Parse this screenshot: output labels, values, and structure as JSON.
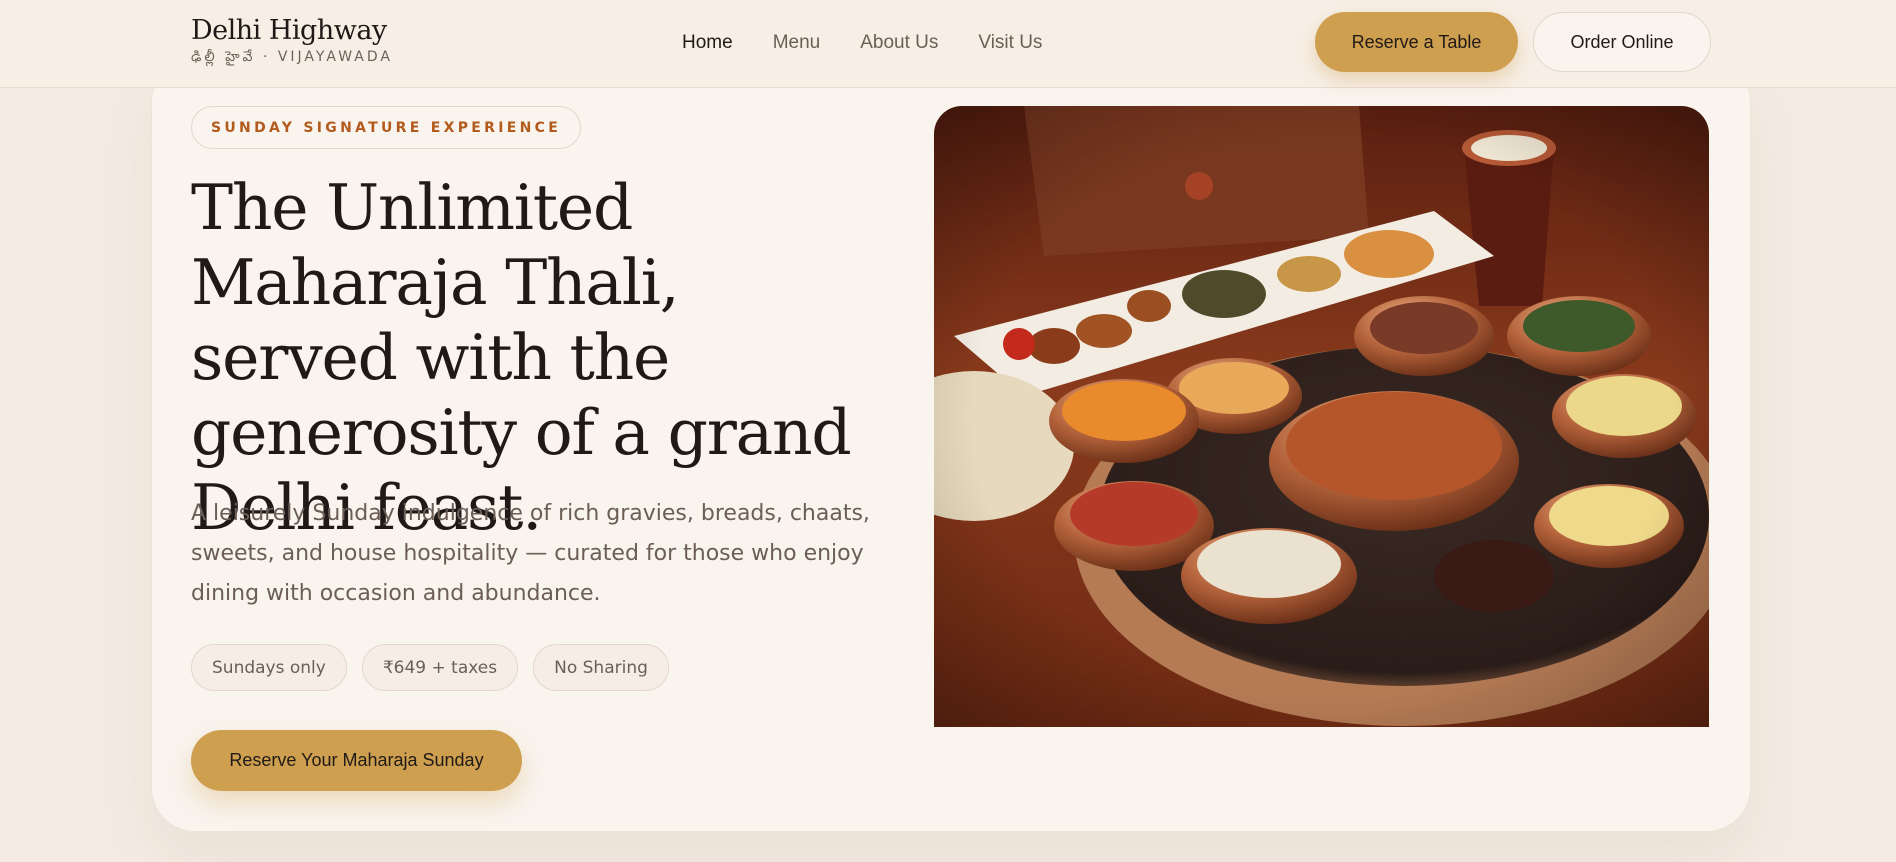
{
  "brand": {
    "name": "Delhi Highway",
    "subtitle": "ఢిల్లీ హైవే · VIJAYAWADA"
  },
  "nav": {
    "items": [
      {
        "label": "Home",
        "active": true
      },
      {
        "label": "Menu",
        "active": false
      },
      {
        "label": "About Us",
        "active": false
      },
      {
        "label": "Visit Us",
        "active": false
      }
    ]
  },
  "header_actions": {
    "reserve_label": "Reserve a Table",
    "order_label": "Order Online"
  },
  "hero": {
    "eyebrow": "SUNDAY SIGNATURE EXPERIENCE",
    "title": "The Unlimited Maharaja Thali, served with the generosity of a grand Delhi feast.",
    "description": "A leisurely Sunday indulgence of rich gravies, breads, chaats, sweets, and house hospitality — curated for those who enjoy dining with occasion and abundance.",
    "pills": [
      "Sundays only",
      "₹649 + taxes",
      "No Sharing"
    ],
    "cta_label": "Reserve Your Maharaja Sunday"
  },
  "colors": {
    "accent": "#cf9f50",
    "eyebrow_text": "#b35a1d",
    "page_bg": "#f4ece3",
    "card_bg": "#f9f4ee"
  },
  "icons": {
    "hero_image": "maharaja-thali-photo"
  }
}
